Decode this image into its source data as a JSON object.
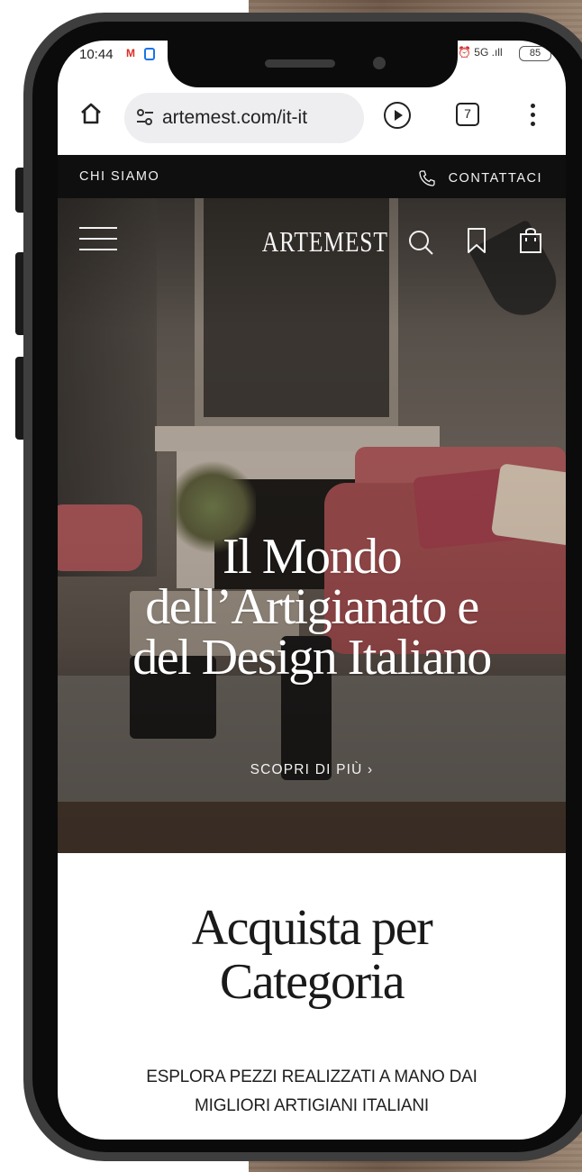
{
  "status_bar": {
    "time": "10:44",
    "gmail_badge": "M",
    "signal": "⏰ 5G .ıll",
    "battery": "85"
  },
  "browser": {
    "url": "artemest.com/it-it",
    "tabs_count": "7"
  },
  "topbar": {
    "about": "CHI SIAMO",
    "contact": "CONTATTACI"
  },
  "header": {
    "logo": "ARTEMEST"
  },
  "hero": {
    "title_lines": [
      "Il Mondo",
      "dell’Artigianato e",
      "del Design Italiano"
    ],
    "cta": "SCOPRI DI PIÙ ›"
  },
  "category_section": {
    "title_lines": [
      "Acquista per",
      "Categoria"
    ],
    "subtitle_lines": [
      "ESPLORA PEZZI REALIZZATI A MANO DAI",
      "MIGLIORI ARTIGIANI ITALIANI"
    ]
  }
}
